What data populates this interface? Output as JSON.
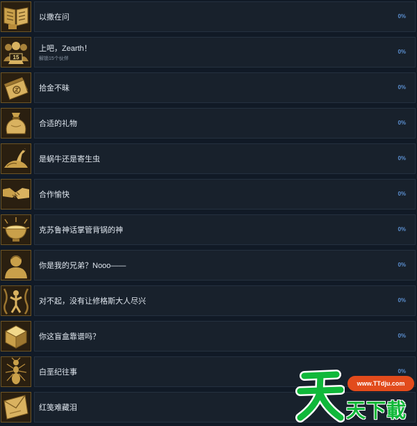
{
  "achievements": [
    {
      "title": "以撒在问",
      "subtitle": "",
      "progress": "0%",
      "icon": "open-book-icon"
    },
    {
      "title": "上吧，Zearth！",
      "subtitle": "解锁15个伙伴",
      "progress": "0%",
      "icon": "party-15-icon"
    },
    {
      "title": "拾金不昧",
      "subtitle": "",
      "progress": "0%",
      "icon": "money-bill-icon"
    },
    {
      "title": "合适的礼物",
      "subtitle": "",
      "progress": "0%",
      "icon": "gift-sack-icon"
    },
    {
      "title": "是蜗牛还是寄生虫",
      "subtitle": "",
      "progress": "0%",
      "icon": "snail-creature-icon"
    },
    {
      "title": "合作愉快",
      "subtitle": "",
      "progress": "0%",
      "icon": "handshake-icon"
    },
    {
      "title": "克苏鲁神话掌管背锅的神",
      "subtitle": "",
      "progress": "0%",
      "icon": "bowl-icon"
    },
    {
      "title": "你是我的兄弟？Nooo——",
      "subtitle": "",
      "progress": "0%",
      "icon": "person-silhouette-icon"
    },
    {
      "title": "对不起，没有让修格斯大人尽兴",
      "subtitle": "",
      "progress": "0%",
      "icon": "tentacle-figure-icon"
    },
    {
      "title": "你这盲盒靠谱吗？",
      "subtitle": "",
      "progress": "0%",
      "icon": "mystery-box-icon"
    },
    {
      "title": "白垩纪往事",
      "subtitle": "",
      "progress": "0%",
      "icon": "ant-icon"
    },
    {
      "title": "红笺难藏泪",
      "subtitle": "",
      "progress": "0%",
      "icon": "letter-icon"
    }
  ],
  "watermark": {
    "url": "www.TTdju.com",
    "brand": "天下載",
    "mark": "天"
  },
  "colors": {
    "background": "#111a26",
    "panel": "#18212c",
    "percent": "#5b8fd0",
    "icon_gold": "#c9a04a",
    "watermark_green": "#10b83a",
    "watermark_orange": "#e24b1c"
  }
}
